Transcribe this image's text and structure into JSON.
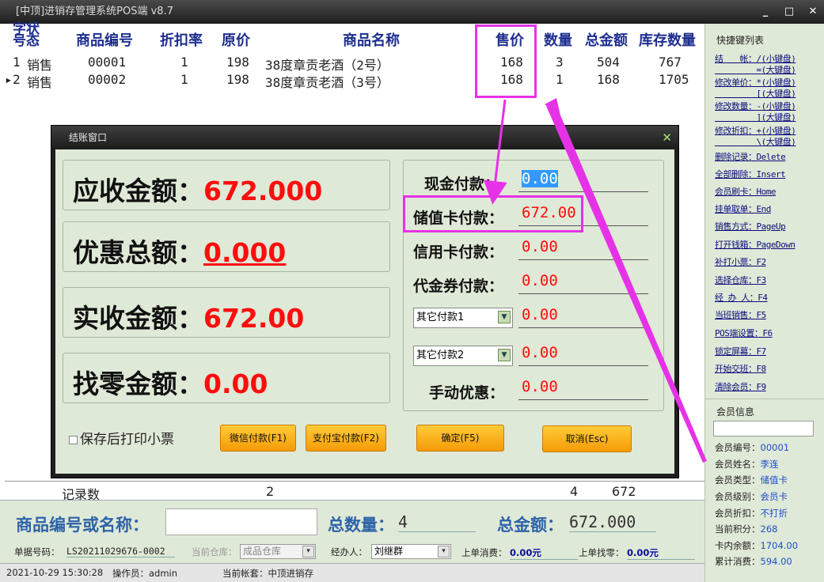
{
  "window": {
    "title": "[中顶]进销存管理系统POS端 v8.7",
    "buttons": [
      "_",
      "□",
      "✕"
    ]
  },
  "grid": {
    "headers": {
      "seq_status": [
        "字状",
        "号态"
      ],
      "code": "商品编号",
      "discount": "折扣率",
      "price": "原价",
      "name": "商品名称",
      "sale_price": "售价",
      "qty": "数量",
      "total": "总金额",
      "stock": "库存数量"
    },
    "rows": [
      {
        "marker": "",
        "seq": "1",
        "status": "销售",
        "code": "00001",
        "discount": "1",
        "price": "198",
        "name": "38度章贡老酒（2号）",
        "sale_price": "168",
        "qty": "3",
        "total": "504",
        "stock": "767"
      },
      {
        "marker": "▸",
        "seq": "2",
        "status": "销售",
        "code": "00002",
        "discount": "1",
        "price": "198",
        "name": "38度章贡老酒（3号）",
        "sale_price": "168",
        "qty": "1",
        "total": "168",
        "stock": "1705"
      }
    ],
    "footer": {
      "label": "记录数",
      "count": "2",
      "qty": "4",
      "total": "672"
    }
  },
  "dialog": {
    "title": "结账窗口",
    "close": "✕",
    "amounts": [
      {
        "label": "应收金额：",
        "value": "672.000",
        "underline": false
      },
      {
        "label": "优惠总额：",
        "value": "0.000",
        "underline": true
      },
      {
        "label": "实收金额：",
        "value": "672.00",
        "underline": false
      },
      {
        "label": "找零金额：",
        "value": "0.00",
        "underline": false
      }
    ],
    "payments": {
      "cash": {
        "label": "现金付款：",
        "value": "0.00"
      },
      "stored_card": {
        "label": "储值卡付款：",
        "value": "672.00"
      },
      "credit_card": {
        "label": "信用卡付款：",
        "value": "0.00"
      },
      "voucher": {
        "label": "代金券付款：",
        "value": "0.00"
      },
      "other1": {
        "select": "其它付款1",
        "value": "0.00"
      },
      "other2": {
        "select": "其它付款2",
        "value": "0.00"
      },
      "manual_discount": {
        "label": "手动优惠：",
        "value": "0.00"
      }
    },
    "print_checkbox": "保存后打印小票",
    "buttons": {
      "wechat": "微信付款(F1)",
      "alipay": "支付宝付款(F2)",
      "confirm": "确定(F5)",
      "cancel": "取消(Esc)"
    }
  },
  "sidebar": {
    "shortcuts_title": "快捷键列表",
    "shortcuts": [
      "结　　帐：/(小键盘)",
      "　　　　　=(大键盘)",
      "修改单价：*(小键盘)",
      "　　　　　[(大键盘)",
      "修改数量：-(小键盘)",
      "　　　　　](大键盘)",
      "修改折扣：+(小键盘)",
      "　　　　　\\(大键盘)",
      "删除记录：Delete",
      "全部删除：Insert",
      "会员刷卡：Home",
      "挂单取单：End",
      "销售方式：PageUp",
      "打开钱箱：PageDown",
      "补打小票：F2",
      "选择仓库：F3",
      "经 办 人：F4",
      "当班销售：F5",
      "POS端设置：F6",
      "锁定屏幕：F7",
      "开始交班：F8",
      "清除会员：F9"
    ],
    "member_title": "会员信息",
    "member": [
      {
        "label": "会员编号：",
        "value": "00001"
      },
      {
        "label": "会员姓名：",
        "value": "李连"
      },
      {
        "label": "会员类型：",
        "value": "储值卡"
      },
      {
        "label": "会员级别：",
        "value": "会员卡"
      },
      {
        "label": "会员折扣：",
        "value": "不打折"
      },
      {
        "label": "当前积分：",
        "value": "268"
      },
      {
        "label": "卡内余额：",
        "value": "1704.00"
      },
      {
        "label": "累计消费：",
        "value": "594.00"
      }
    ]
  },
  "bottom": {
    "search_label": "商品编号或名称：",
    "search_value": "",
    "total_qty_label": "总数量：",
    "total_qty": "4",
    "total_amount_label": "总金额：",
    "total_amount": "672.000",
    "doc_label": "单据号码：",
    "doc_no": "LS20211029676-0002",
    "warehouse_label": "当前仓库：",
    "warehouse": "成品仓库",
    "handler_label": "经办人：",
    "handler": "刘继群",
    "last_spend_label": "上单消费：",
    "last_spend": "0.00元",
    "last_change_label": "上单找零：",
    "last_change": "0.00元"
  },
  "status": {
    "datetime": "2021-10-29 15:30:28",
    "operator": "操作员：admin",
    "account": "当前帐套：中顶进销存"
  },
  "colors": {
    "accent": "#e632e6",
    "amount_red": "#ff0d0d",
    "header_blue": "#1e2e8e"
  }
}
